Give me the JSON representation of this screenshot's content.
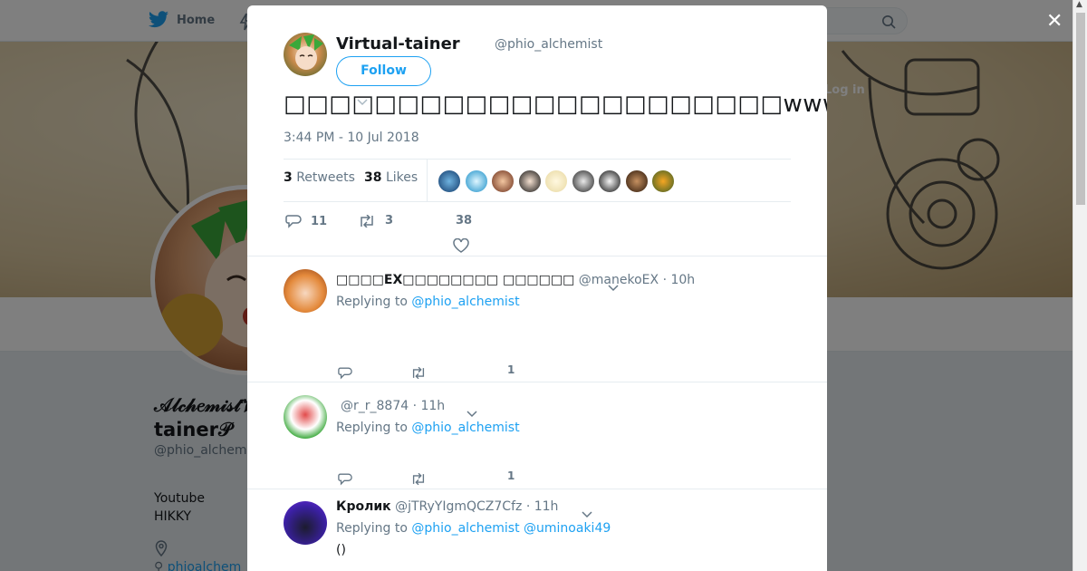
{
  "nav": {
    "home_label": "Home"
  },
  "background_profile": {
    "name": "𝒜𝓁𝒸𝒽𝑒𝓂𝒾𝓈𝓉𝒱𝒾𝓇𝓉𝓊𝒶𝓁-tainer𝒫",
    "handle": "@phio_alchem",
    "bio_line1": "Youtube",
    "bio_line2": "HIKKY",
    "link": "phioalchem",
    "login_label": "Log in"
  },
  "tweet": {
    "author_name": "Virtual-tainer",
    "author_handle": "@phio_alchemist",
    "follow_label": "Follow",
    "text": "□□□□□□□□□□□□□□□□□□□□□□www",
    "timestamp": "3:44 PM - 10 Jul 2018",
    "retweets_count": "3",
    "retweets_label": "Retweets",
    "likes_count": "38",
    "likes_label": "Likes",
    "reply_count": "11",
    "retweet_count": "3",
    "like_count": "38"
  },
  "replies": [
    {
      "name": "□□□□EX□□□□□□□□ □□□□□□",
      "handle": "@manekoEX",
      "time": "· 10h",
      "replying_label": "Replying to",
      "replying_to": "@phio_alchemist",
      "text": "",
      "like_count": "1"
    },
    {
      "name": "",
      "handle": "@r_r_8874",
      "time": "· 11h",
      "replying_label": "Replying to",
      "replying_to": "@phio_alchemist",
      "text": "",
      "like_count": "1"
    },
    {
      "name": "Кролик",
      "handle": "@jTRyYIgmQCZ7Cfz",
      "time": "· 11h",
      "replying_label": "Replying to",
      "replying_to": "@phio_alchemist",
      "replying_to_2": "@uminoaki49",
      "text": "()",
      "like_count": ""
    }
  ],
  "colors": {
    "accent": "#1da1f2",
    "muted": "#657786",
    "text": "#14171a"
  }
}
